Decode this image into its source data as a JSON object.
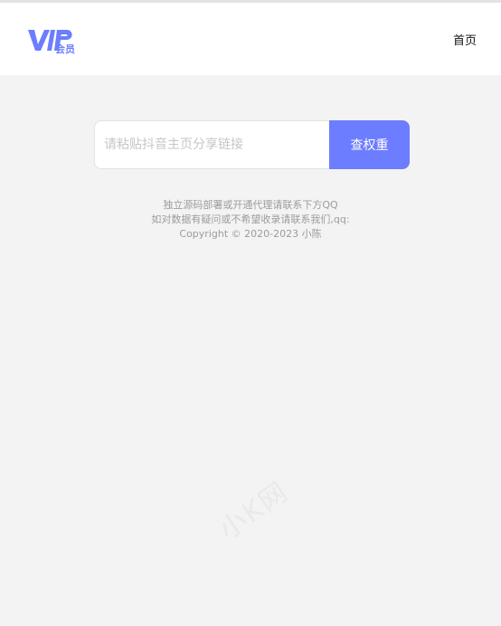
{
  "header": {
    "logo_text": "VIP会员",
    "nav_home": "首页"
  },
  "search": {
    "placeholder": "请粘贴抖音主页分享链接",
    "value": "",
    "button_label": "查权重"
  },
  "footer": {
    "line1": "独立源码部署或开通代理请联系下方QQ",
    "line2": "如对数据有疑问或不希望收录请联系我们,qq:",
    "line3": "Copyright © 2020-2023 小陈"
  },
  "watermark": "小K网",
  "colors": {
    "accent": "#6c7dff",
    "background": "#f3f3f3"
  }
}
